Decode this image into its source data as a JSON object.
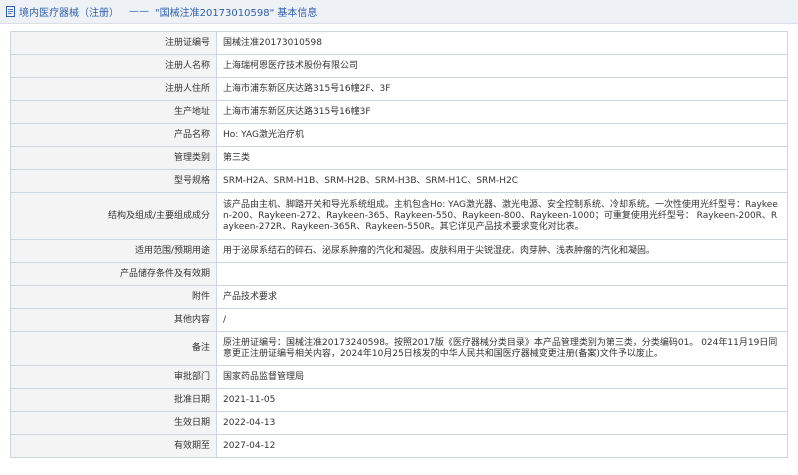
{
  "breadcrumb": {
    "section": "境内医疗器械（注册）",
    "separator": "——",
    "detail": "\"国械注准20173010598\" 基本信息"
  },
  "rows": [
    {
      "label": "注册证编号",
      "value": "国械注准20173010598"
    },
    {
      "label": "注册人名称",
      "value": "上海瑞柯恩医疗技术股份有限公司"
    },
    {
      "label": "注册人住所",
      "value": "上海市浦东新区庆达路315号16幢2F、3F"
    },
    {
      "label": "生产地址",
      "value": "上海市浦东新区庆达路315号16幢3F"
    },
    {
      "label": "产品名称",
      "value": "Ho: YAG激光治疗机"
    },
    {
      "label": "管理类别",
      "value": "第三类"
    },
    {
      "label": "型号规格",
      "value": "SRM-H2A、SRM-H1B、SRM-H2B、SRM-H3B、SRM-H1C、SRM-H2C"
    },
    {
      "label": "结构及组成/主要组成成分",
      "value": "该产品由主机、脚踏开关和导光系统组成。主机包含Ho: YAG激光器、激光电源、安全控制系统、冷却系统。一次性使用光纤型号：Raykeen-200、Raykeen-272、Raykeen-365、Raykeen-550、Raykeen-800、Raykeen-1000；可重复使用光纤型号： Raykeen-200R、Raykeen-272R、Raykeen-365R、Raykeen-550R。其它详见产品技术要求变化对比表。"
    },
    {
      "label": "适用范围/预期用途",
      "value": "用于泌尿系结石的碎石、泌尿系肿瘤的汽化和凝固。皮肤科用于尖锐湿疣、肉芽肿、浅表肿瘤的汽化和凝固。"
    },
    {
      "label": "产品储存条件及有效期",
      "value": ""
    },
    {
      "label": "附件",
      "value": "产品技术要求"
    },
    {
      "label": "其他内容",
      "value": "/"
    },
    {
      "label": "备注",
      "value": "原注册证编号：国械注准20173240598。按照2017版《医疗器械分类目录》本产品管理类别为第三类，分类编码01。 024年11月19日同意更正注册证编号相关内容，2024年10月25日核发的中华人民共和国医疗器械变更注册(备案)文件予以废止。"
    },
    {
      "label": "审批部门",
      "value": "国家药品监督管理局"
    },
    {
      "label": "批准日期",
      "value": "2021-11-05"
    },
    {
      "label": "生效日期",
      "value": "2022-04-13"
    },
    {
      "label": "有效期至",
      "value": "2027-04-12"
    }
  ]
}
